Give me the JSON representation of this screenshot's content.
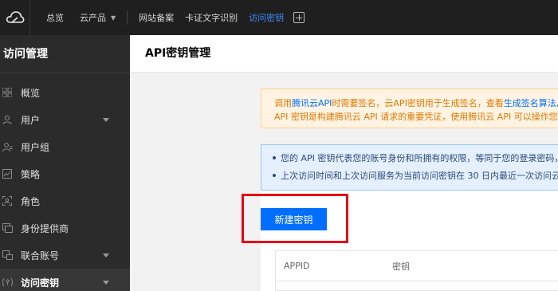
{
  "topbar": {
    "nav": [
      {
        "label": "总览"
      },
      {
        "label": "云产品"
      },
      {
        "label": "网站备案"
      },
      {
        "label": "卡证文字识别"
      },
      {
        "label": "访问密钥"
      }
    ],
    "active_color": "#3d8bff"
  },
  "sidebar": {
    "title": "访问管理",
    "items": [
      {
        "label": "概览",
        "icon": "grid-icon"
      },
      {
        "label": "用户",
        "icon": "user-icon",
        "expandable": true
      },
      {
        "label": "用户组",
        "icon": "user-group-icon"
      },
      {
        "label": "策略",
        "icon": "policy-icon"
      },
      {
        "label": "角色",
        "icon": "role-icon"
      },
      {
        "label": "身份提供商",
        "icon": "identity-provider-icon"
      },
      {
        "label": "联合账号",
        "icon": "federated-account-icon",
        "expandable": true
      },
      {
        "label": "访问密钥",
        "icon": "key-icon",
        "expandable": true,
        "active": true
      }
    ]
  },
  "main": {
    "title": "API密钥管理",
    "warning": {
      "line1_pre": "调用",
      "line1_link1": "腾讯云API",
      "line1_mid": "时需要签名，云API密钥用于生成签名，查看",
      "line1_link2": "生成签名算法,",
      "line2": "API 密钥是构建腾讯云 API 请求的重要凭证，使用腾讯云 API 可以操作您",
      "color": "#e27800",
      "background": "#fff4e3"
    },
    "info": {
      "line1": "您的 API 密钥代表您的账号身份和所拥有的权限，等同于您的登录密码，",
      "line2": "上次访问时间和上次访问服务为当前访问密钥在 30 日内最近一次访问云"
    },
    "create_button": "新建密钥",
    "table": {
      "columns": [
        "APPID",
        "密钥"
      ]
    }
  },
  "colors": {
    "primary": "#006eff",
    "highlight": "#e60012"
  }
}
